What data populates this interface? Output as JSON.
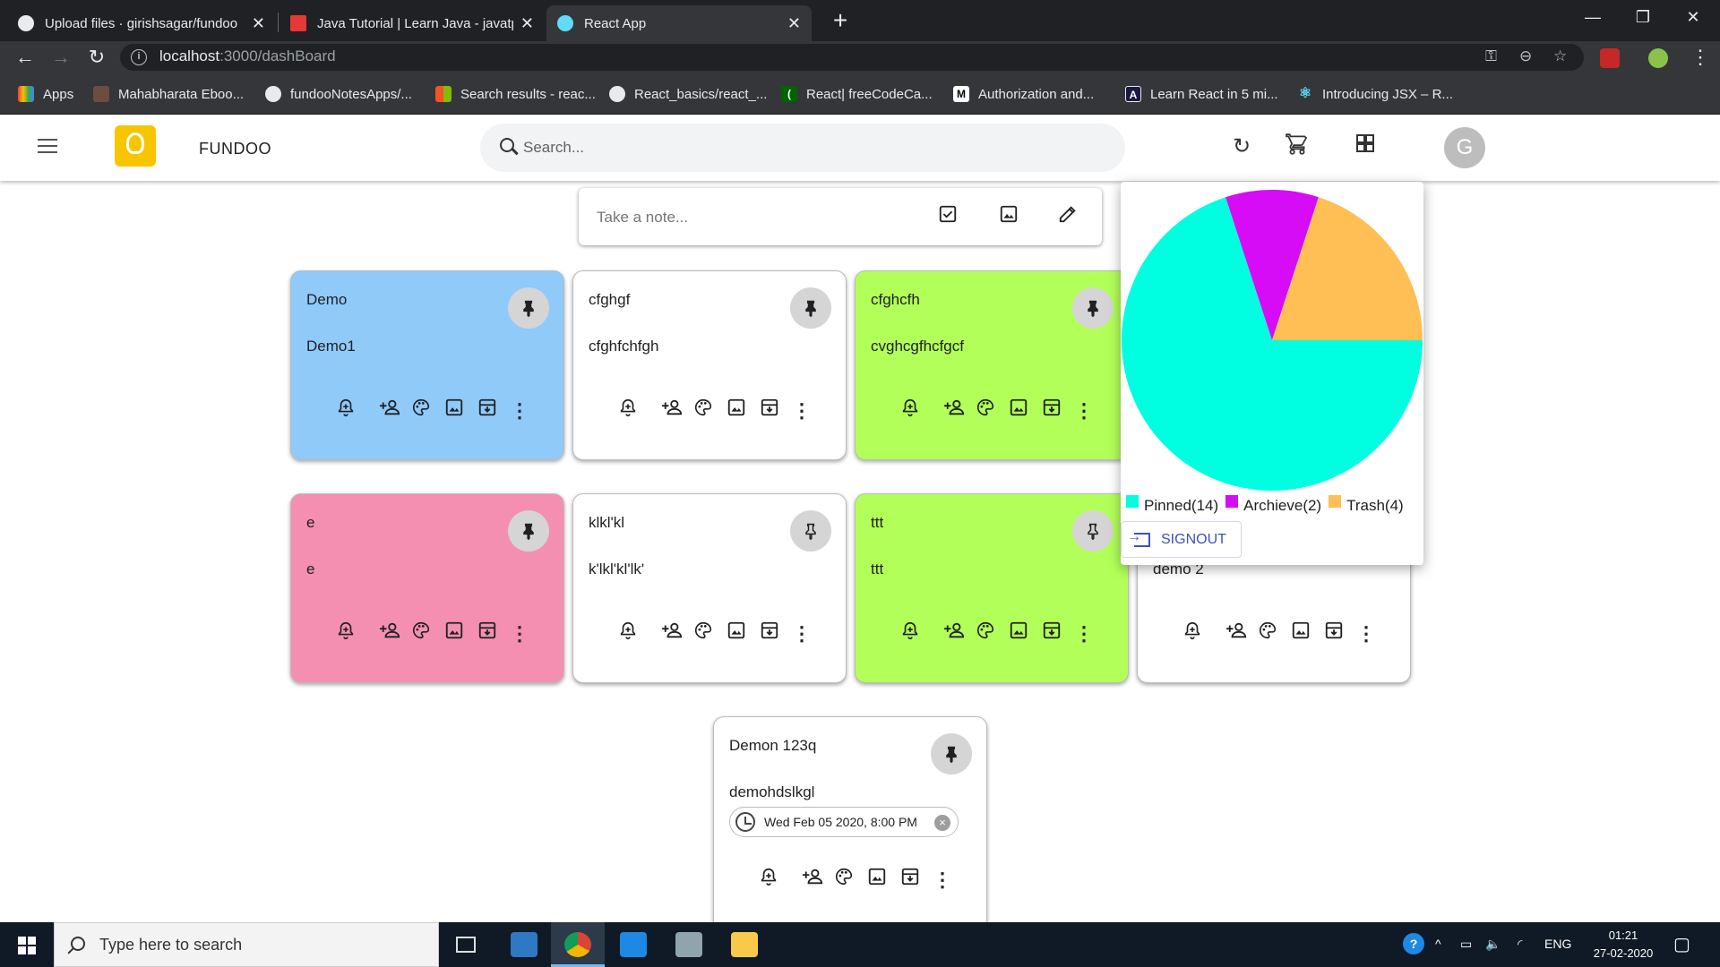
{
  "browser": {
    "tabs": [
      {
        "label": "Upload files · girishsagar/fundoo",
        "icon": "github-icon",
        "color": "#e8eaed"
      },
      {
        "label": "Java Tutorial | Learn Java - javatp",
        "icon": "javatpoint-icon",
        "color": "#e53935"
      },
      {
        "label": "React App",
        "icon": "react-icon",
        "color": "#61dafb"
      }
    ],
    "url_host": "localhost",
    "url_path": ":3000/dashBoard",
    "bookmarks": [
      {
        "label": "Apps",
        "icon": "apps-grid-icon",
        "color": "#ea4335"
      },
      {
        "label": "Mahabharata Eboo...",
        "icon": "book-icon",
        "color": "#6d4c41"
      },
      {
        "label": "fundooNotesApps/...",
        "icon": "github-icon",
        "color": "#202124"
      },
      {
        "label": "Search results - reac...",
        "icon": "microsoft-icon",
        "color": "#f35325"
      },
      {
        "label": "React_basics/react_...",
        "icon": "github-icon",
        "color": "#202124"
      },
      {
        "label": "React| freeCodeCa...",
        "icon": "freecodecamp-icon",
        "color": "#006400"
      },
      {
        "label": "Authorization and...",
        "icon": "medium-icon",
        "color": "#000000"
      },
      {
        "label": "Learn React in 5 mi...",
        "icon": "scrimba-icon",
        "color": "#1a1a40"
      },
      {
        "label": "Introducing JSX – R...",
        "icon": "react-icon",
        "color": "#61dafb"
      }
    ]
  },
  "app": {
    "title": "FUNDOO",
    "search_placeholder": "Search...",
    "avatar_letter": "G",
    "take_note_placeholder": "Take a note..."
  },
  "notes": [
    {
      "title": "Demo",
      "body": "Demo1",
      "color": "#90caf9",
      "pinned": true
    },
    {
      "title": "cfghgf",
      "body": "cfghfchfgh",
      "color": "#ffffff",
      "pinned": true
    },
    {
      "title": "cfghcfh",
      "body": "cvghcgfhcfgcf",
      "color": "#b2ff59",
      "pinned": true
    },
    {
      "title": "e",
      "body": "e",
      "color": "#f48fb1",
      "pinned": true
    },
    {
      "title": "klkl'kl",
      "body": "k'lkl'kl'lk'",
      "color": "#ffffff",
      "pinned": false
    },
    {
      "title": "ttt",
      "body": "ttt",
      "color": "#b2ff59",
      "pinned": false
    },
    {
      "title": "",
      "body": "demo 2",
      "color": "#ffffff",
      "pinned": false
    },
    {
      "title": "Demon 123q",
      "body": "demohdslkgl",
      "color": "#ffffff",
      "pinned": true,
      "reminder": "Wed Feb 05 2020, 8:00 PM"
    }
  ],
  "chart_data": {
    "type": "pie",
    "slices": [
      {
        "label": "Pinned(14)",
        "value": 14,
        "color": "#00ffe1"
      },
      {
        "label": "Archieve(2)",
        "value": 2,
        "color": "#d50cf5"
      },
      {
        "label": "Trash(4)",
        "value": 4,
        "color": "#ffbf55"
      }
    ],
    "legend_position": "bottom"
  },
  "signout_label": "SIGNOUT",
  "taskbar": {
    "search_placeholder": "Type here to search",
    "language": "ENG",
    "time": "01:21",
    "date": "27-02-2020"
  }
}
